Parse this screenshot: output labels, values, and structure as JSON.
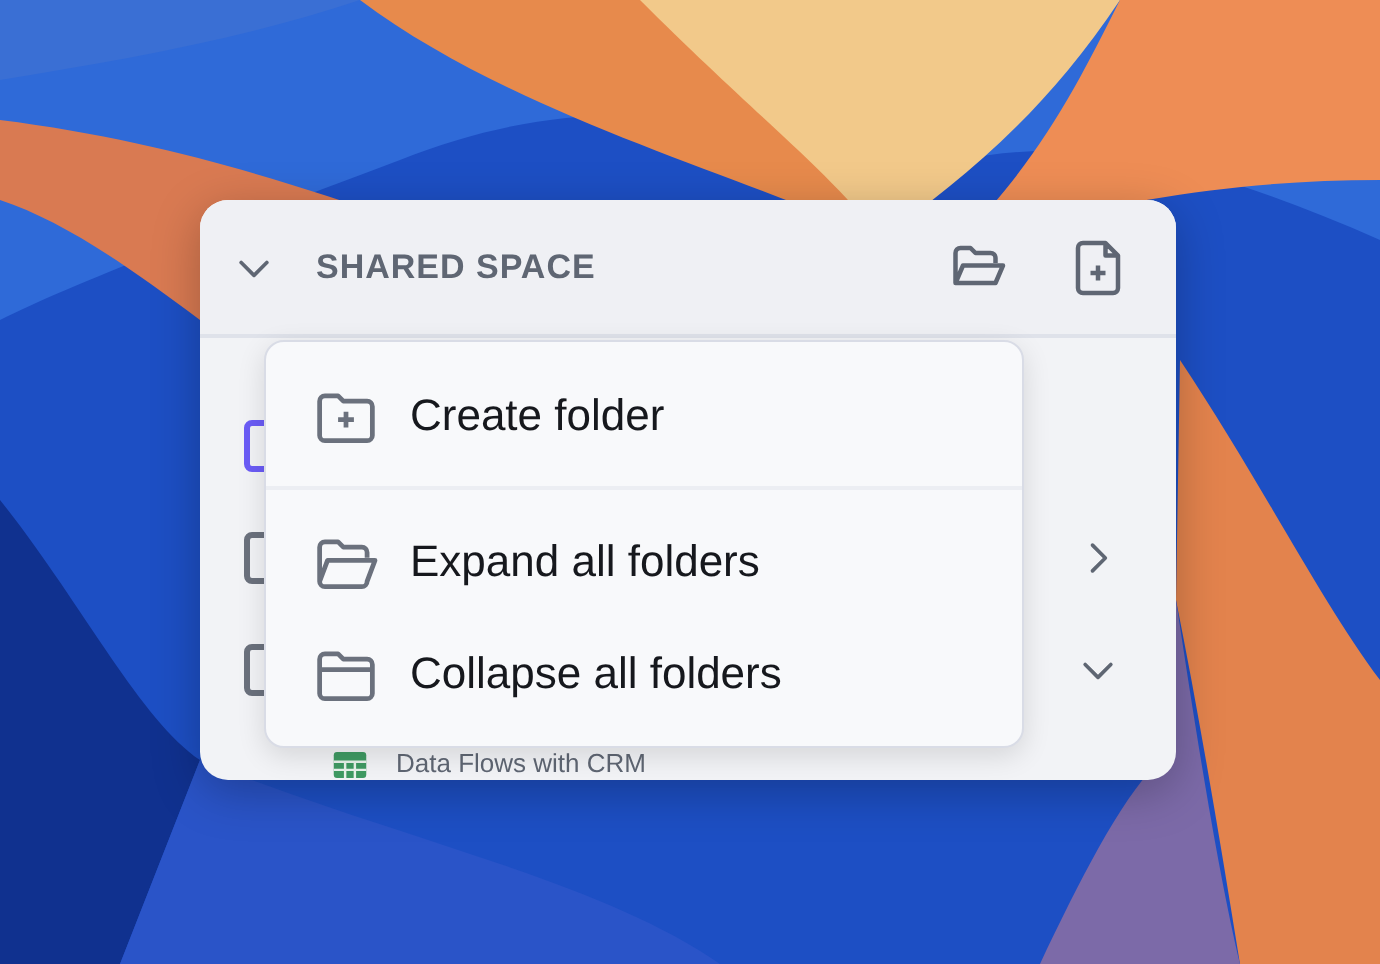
{
  "panel": {
    "title": "SHARED SPACE",
    "expanded": true,
    "rows": [
      {
        "kind": "item",
        "color": "#6b5cf6"
      },
      {
        "kind": "folder",
        "expanded": false
      },
      {
        "kind": "folder",
        "expanded": true
      },
      {
        "kind": "sheet",
        "label": "Data Flows with CRM"
      }
    ]
  },
  "menu": {
    "items": [
      {
        "kind": "create",
        "label": "Create folder"
      },
      {
        "kind": "expand",
        "label": "Expand all folders"
      },
      {
        "kind": "collapse",
        "label": "Collapse all folders"
      }
    ]
  }
}
